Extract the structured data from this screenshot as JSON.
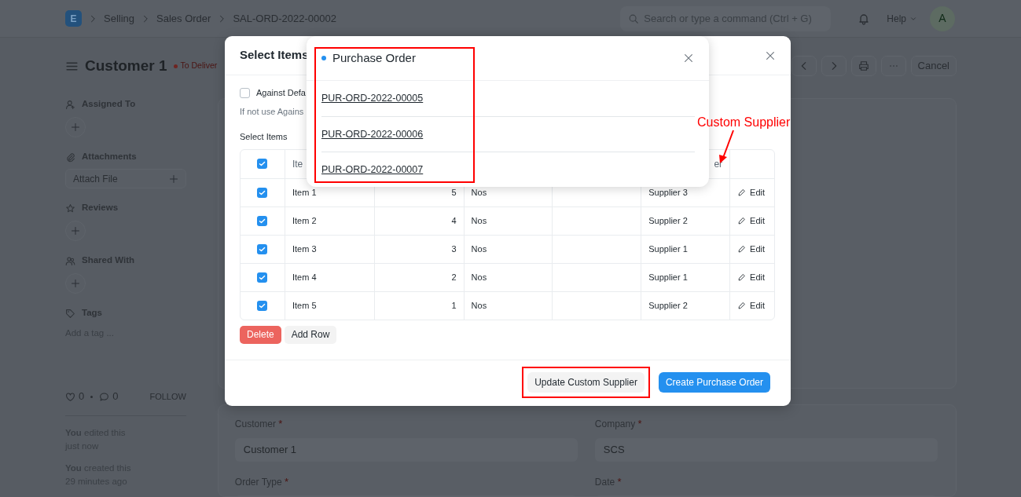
{
  "navbar": {
    "logo": "E",
    "breadcrumbs": [
      "Selling",
      "Sales Order",
      "SAL-ORD-2022-00002"
    ],
    "search": {
      "placeholder": "Search or type a command (Ctrl + G)"
    },
    "help": "Help",
    "avatar": "A"
  },
  "page_header": {
    "title": "Customer 1",
    "status": "To Deliver",
    "cancel": "Cancel"
  },
  "sidebar": {
    "sections": [
      {
        "kind": "assign",
        "label": "Assigned To"
      },
      {
        "kind": "attach",
        "label": "Attachments",
        "button": "Attach File"
      },
      {
        "kind": "review",
        "label": "Reviews"
      },
      {
        "kind": "share",
        "label": "Shared With"
      },
      {
        "kind": "tags",
        "label": "Tags",
        "placeholder": "Add a tag ..."
      }
    ],
    "likes": "0",
    "comments": "0",
    "follow": "FOLLOW",
    "activity": [
      {
        "text": "**You** edited this",
        "time": "just now"
      },
      {
        "text": "**You** created this",
        "time": "29 minutes ago"
      }
    ]
  },
  "form": {
    "fields": [
      {
        "label": "Customer",
        "marker": "*",
        "value": "Customer 1"
      },
      {
        "label": "Company",
        "marker": "*",
        "value": "SCS"
      },
      {
        "label": "Order Type",
        "marker": "*"
      },
      {
        "label": "Date",
        "marker": "*"
      }
    ]
  },
  "dialog": {
    "title": "Select Items",
    "against_default": {
      "label": "Against Defa",
      "checked": false
    },
    "help": "If not use Agains",
    "table_label": "Select Items",
    "header_checked": true,
    "columns": [
      "Ite",
      null,
      null,
      null,
      "er",
      null
    ],
    "rows": [
      {
        "checked": true,
        "item": "Item 1",
        "qty": "5",
        "uom": "Nos",
        "supplier": "Supplier 3",
        "action": "Edit"
      },
      {
        "checked": true,
        "item": "Item 2",
        "qty": "4",
        "uom": "Nos",
        "supplier": "Supplier 2",
        "action": "Edit"
      },
      {
        "checked": true,
        "item": "Item 3",
        "qty": "3",
        "uom": "Nos",
        "supplier": "Supplier 1",
        "action": "Edit"
      },
      {
        "checked": true,
        "item": "Item 4",
        "qty": "2",
        "uom": "Nos",
        "supplier": "Supplier 1",
        "action": "Edit"
      },
      {
        "checked": true,
        "item": "Item 5",
        "qty": "1",
        "uom": "Nos",
        "supplier": "Supplier 2",
        "action": "Edit"
      }
    ],
    "delete": "Delete",
    "add_row": "Add Row",
    "footer": [
      {
        "kind": "secondary",
        "label": "Update Custom Supplier",
        "highlighted": true
      },
      {
        "kind": "primary",
        "label": "Create Purchase Order",
        "highlighted": false
      }
    ]
  },
  "popover": {
    "title": "Purchase Order",
    "highlighted": true,
    "links": [
      "PUR-ORD-2022-00005",
      "PUR-ORD-2022-00006",
      "PUR-ORD-2022-00007"
    ]
  },
  "annotation": {
    "text": "Custom Supplier"
  }
}
